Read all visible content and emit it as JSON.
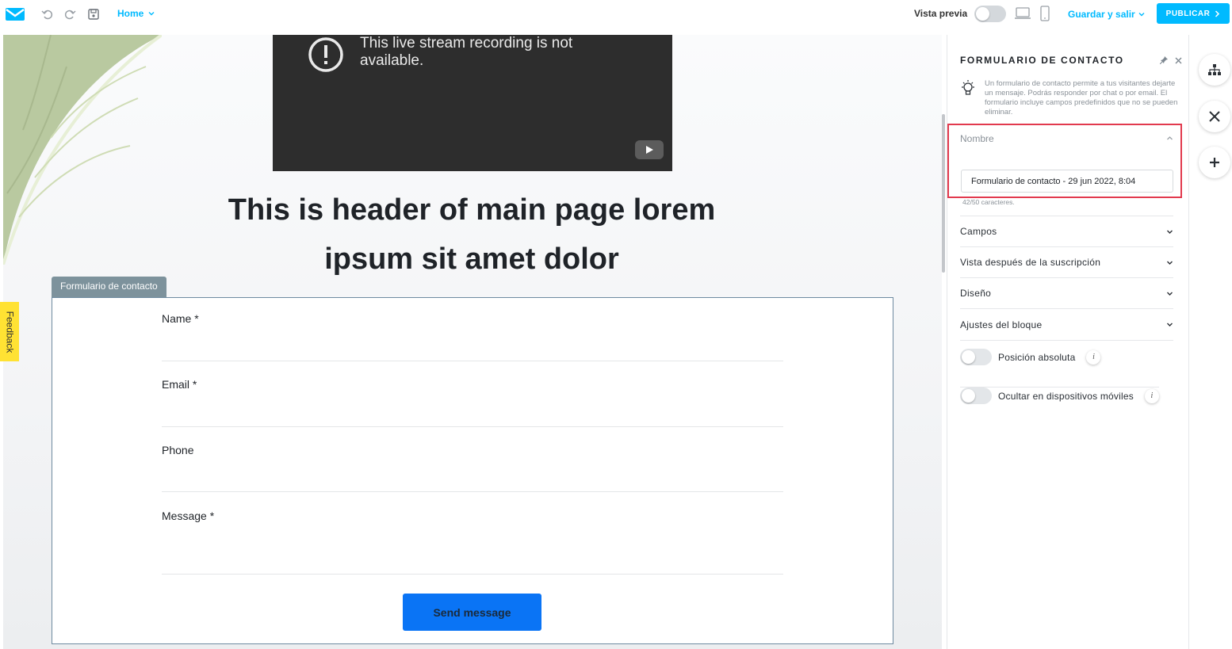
{
  "topbar": {
    "home_label": "Home",
    "preview_label": "Vista previa",
    "save_exit_label": "Guardar y salir",
    "publish_label": "PUBLICAR"
  },
  "canvas": {
    "video_message": "This live stream recording is not available.",
    "heading_line1": "This is header of main page lorem",
    "heading_line2": "ipsum sit amet dolor",
    "form_tab_label": "Formulario de contacto",
    "fields": [
      "Name *",
      "Email *",
      "Phone",
      "Message *"
    ],
    "send_label": "Send message",
    "feedback_label": "Feedback"
  },
  "panel": {
    "title": "FORMULARIO DE CONTACTO",
    "description": "Un formulario de contacto permite a tus visitantes dejarte un mensaje. Podrás responder por chat o por email. El formulario incluye campos predefinidos que no se pueden eliminar.",
    "name_label": "Nombre",
    "name_value": "Formulario de contacto - 29 jun 2022, 8:04",
    "char_count": "42/50 caracteres.",
    "sections": [
      "Campos",
      "Vista después de la suscripción",
      "Diseño",
      "Ajustes del bloque"
    ],
    "toggle_absolute": "Posición absoluta",
    "toggle_mobile": "Ocultar en dispositivos móviles"
  },
  "colors": {
    "accent": "#00baff",
    "publish_bg": "#00baff",
    "send_button": "#0a74f5",
    "highlight": "#e23a4e",
    "feedback": "#ffe233"
  },
  "icons": [
    "logo-icon",
    "undo-icon",
    "redo-icon",
    "save-icon",
    "desktop-icon",
    "mobile-icon",
    "chevron-right-icon",
    "alert-icon",
    "youtube-play-icon",
    "pin-icon",
    "close-icon",
    "bulb-icon",
    "chevron-up-icon",
    "chevron-down-icon",
    "info-icon",
    "sitemap-icon",
    "plus-icon"
  ]
}
